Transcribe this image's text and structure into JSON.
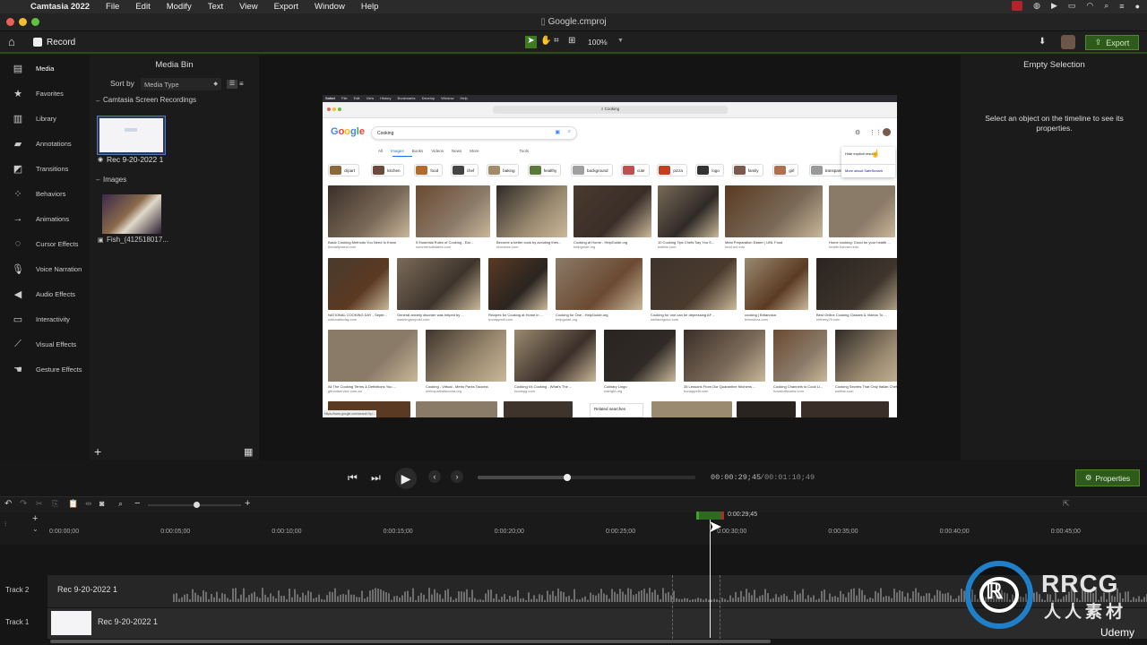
{
  "menubar": {
    "app": "Camtasia 2022",
    "items": [
      "File",
      "Edit",
      "Modify",
      "Text",
      "View",
      "Export",
      "Window",
      "Help"
    ]
  },
  "window": {
    "title": "Google.cmproj"
  },
  "toolbar": {
    "record_label": "Record",
    "zoom": "100%",
    "export_label": "Export"
  },
  "leftnav": {
    "items": [
      {
        "label": "Media",
        "icon": "film-icon"
      },
      {
        "label": "Favorites",
        "icon": "star-icon"
      },
      {
        "label": "Library",
        "icon": "library-icon"
      },
      {
        "label": "Annotations",
        "icon": "annotation-icon"
      },
      {
        "label": "Transitions",
        "icon": "transition-icon"
      },
      {
        "label": "Behaviors",
        "icon": "behavior-icon"
      },
      {
        "label": "Animations",
        "icon": "animation-icon"
      },
      {
        "label": "Cursor Effects",
        "icon": "cursor-icon"
      },
      {
        "label": "Voice Narration",
        "icon": "microphone-icon"
      },
      {
        "label": "Audio Effects",
        "icon": "speaker-icon"
      },
      {
        "label": "Interactivity",
        "icon": "interactivity-icon"
      },
      {
        "label": "Visual Effects",
        "icon": "wand-icon"
      },
      {
        "label": "Gesture Effects",
        "icon": "hand-icon"
      }
    ]
  },
  "mediabin": {
    "title": "Media Bin",
    "sort_label": "Sort by",
    "sort_value": "Media Type",
    "group1": "Camtasia Screen Recordings",
    "item1": "Rec 9-20-2022 1",
    "group2": "Images",
    "item2": "Fish_(412518017..."
  },
  "properties": {
    "title": "Empty Selection",
    "hint": "Select an object on the timeline to see its properties.",
    "button": "Properties"
  },
  "player": {
    "current": "00:00:29;45",
    "total": "00:01:10;49",
    "progress": 0.41
  },
  "timeline": {
    "playhead_label": "0:00:29;45",
    "ticks": [
      "0:00:00;00",
      "0:00:05;00",
      "0:00:10;00",
      "0:00:15;00",
      "0:00:20;00",
      "0:00:25;00",
      "0:00:30;00",
      "0:00:35;00",
      "0:00:40;00",
      "0:00:45;00"
    ],
    "tracks": [
      {
        "name": "Track 2",
        "clip": "Rec 9-20-2022 1"
      },
      {
        "name": "Track 1",
        "clip": "Rec 9-20-2022 1"
      }
    ]
  },
  "browser": {
    "menu": [
      "Safari",
      "File",
      "Edit",
      "View",
      "History",
      "Bookmarks",
      "Develop",
      "Window",
      "Help"
    ],
    "address": "Cooking",
    "search_query": "Cooking",
    "tabs": [
      "All",
      "Images",
      "Books",
      "Videos",
      "News",
      "More",
      "Tools"
    ],
    "chips": [
      "clipart",
      "kitchen",
      "food",
      "chef",
      "baking",
      "healthy",
      "background",
      "cute",
      "pizza",
      "logo",
      "family",
      "girl",
      "transparent"
    ],
    "popup": [
      "Hide explicit results",
      "More about SafeSearch"
    ],
    "row1": [
      {
        "t": "Basic Cooking Methods You Need to Know",
        "s": "thedailymeal.com"
      },
      {
        "t": "5 Essential Rules of Cooking - Ear...",
        "s": "sommersaltdates.com"
      },
      {
        "t": "Become a better cook by avoiding thes...",
        "s": "nbcnews.com"
      },
      {
        "t": "Cooking at Home - HelpGuide.org",
        "s": "helpguide.org"
      },
      {
        "t": "10 Cooking Tips Chefs Say You S...",
        "s": "eatthis.com"
      },
      {
        "t": "Meal Preparation Easier | UNL Food",
        "s": "food.unl.edu"
      },
      {
        "t": "Home cooking: Good for your health ...",
        "s": "health.harvard.edu"
      }
    ],
    "row2": [
      {
        "t": "NATIONAL COOKING DAY - Septe...",
        "s": "nationaltoday.com"
      },
      {
        "t": "General anxiety disorder was helped by ...",
        "s": "washingtonpost.com"
      },
      {
        "t": "Recipes for Cooking at Home in ...",
        "s": "bonappetit.com"
      },
      {
        "t": "Cooking for One - HelpGuide.org",
        "s": "helpguide.org"
      },
      {
        "t": "Cooking for one can be depressing AF ...",
        "s": "wellandgood.com"
      },
      {
        "t": "cooking | Britannica",
        "s": "britannica.com"
      },
      {
        "t": "Best Online Cooking Classes & Videos To ...",
        "s": "refinery29.com"
      }
    ],
    "row3": [
      {
        "t": "All The Cooking Terms & Definitions You ...",
        "s": "gffoodservice.com.au"
      },
      {
        "t": "Cooking - Virtual - Metro Parks Tacoma",
        "s": "metroparkstacoma.org"
      },
      {
        "t": "Cooking Vs Cooking - What's The ...",
        "s": "foodspg.com"
      },
      {
        "t": "Culinary Lingo",
        "s": "eatright.org"
      },
      {
        "t": "35 Lessons From Our Quarantine Kitchens ...",
        "s": "bonappetit.com"
      },
      {
        "t": "Cooking Channels to Cook Li...",
        "s": "howstuffworks.com"
      },
      {
        "t": "Cooking Secrets That Only Italian Chefs ...",
        "s": "eatthis.com"
      }
    ],
    "related": "Related searches",
    "status_url": "https://www.google.com/search?q=..."
  },
  "watermark": {
    "brand": "RRCG",
    "sub": "人人素材",
    "udemy": "Udemy"
  },
  "colors": {
    "accent_green": "#2e5b1a",
    "timeline_clip": "#2c3a2a",
    "audio_wave": "#7a7a7a"
  }
}
